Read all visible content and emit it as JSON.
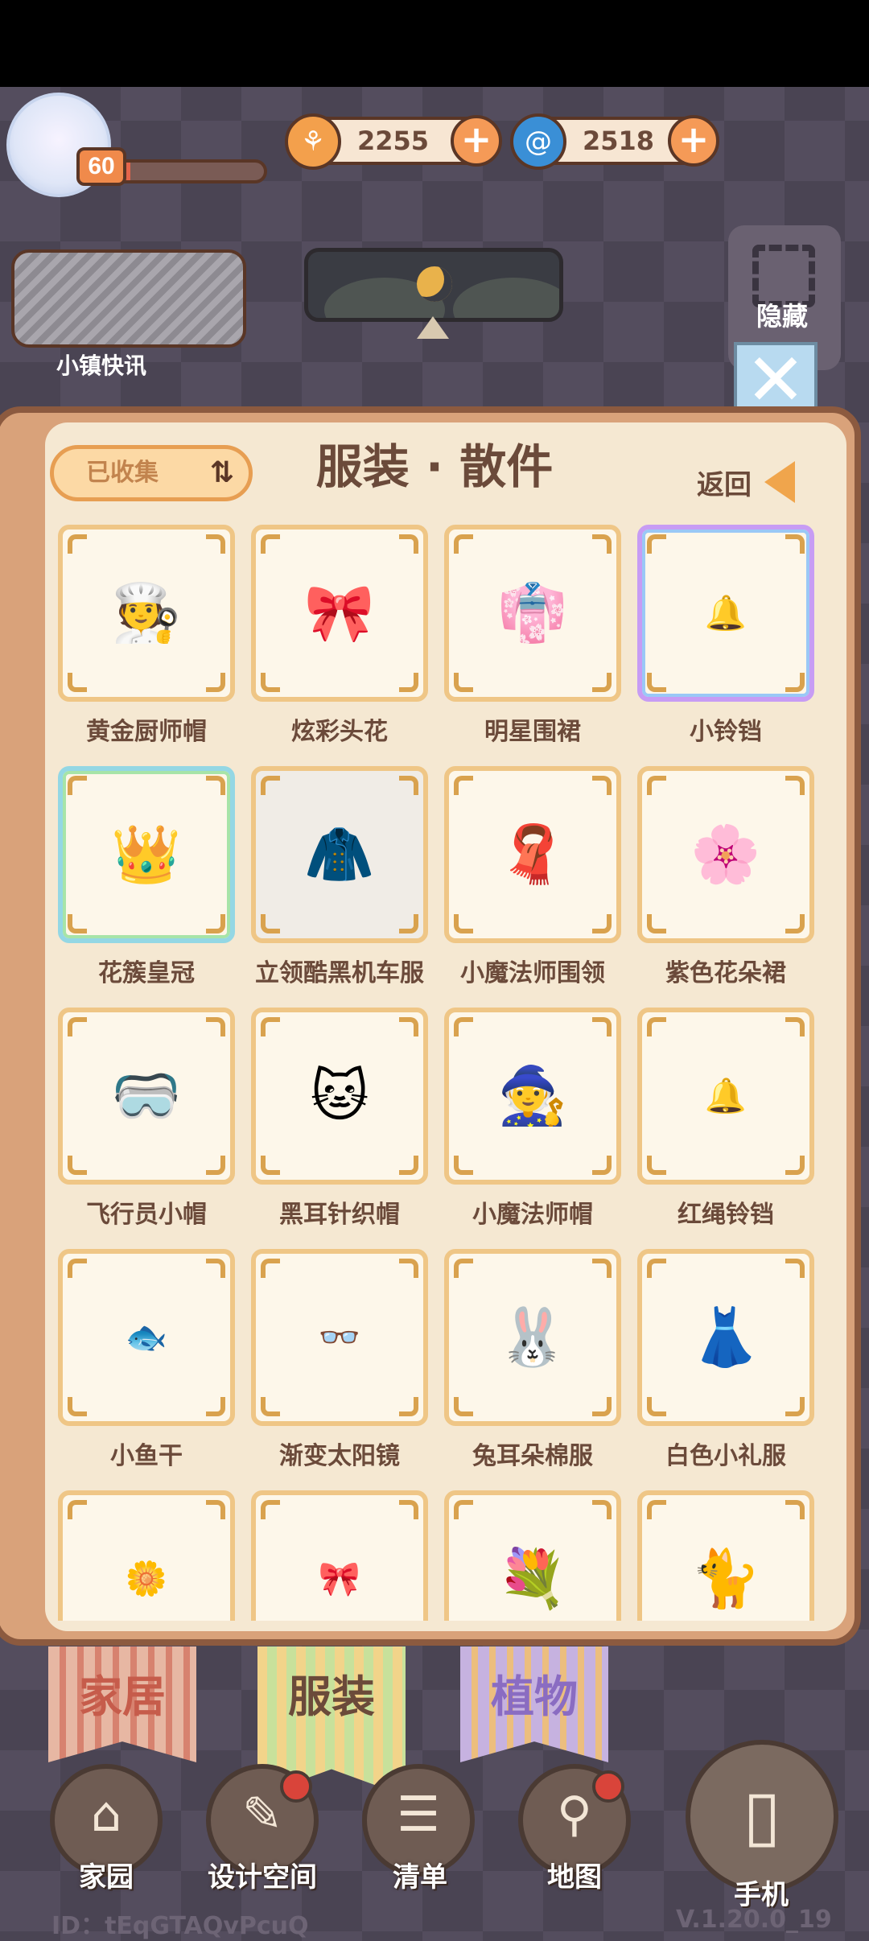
{
  "hud": {
    "level": "60",
    "xp_fraction": 0.1,
    "coins": "2255",
    "gems": "2518",
    "news_label": "小镇快讯",
    "hide_label": "隐藏"
  },
  "panel": {
    "sort_label": "已收集",
    "title": "服装 · 散件",
    "back_label": "返回"
  },
  "items": [
    {
      "name": "黄金厨师帽",
      "icon": "chef-hat",
      "glyph": "🧑‍🍳",
      "rarity": "normal"
    },
    {
      "name": "炫彩头花",
      "icon": "bow",
      "glyph": "🎀",
      "rarity": "normal"
    },
    {
      "name": "明星围裙",
      "icon": "apron",
      "glyph": "👘",
      "rarity": "normal"
    },
    {
      "name": "小铃铛",
      "icon": "bell",
      "glyph": "🔔",
      "rarity": "purple"
    },
    {
      "name": "花簇皇冠",
      "icon": "crown",
      "glyph": "👑",
      "rarity": "blue"
    },
    {
      "name": "立领酷黑机车服",
      "icon": "jacket",
      "glyph": "🧥",
      "rarity": "highlight"
    },
    {
      "name": "小魔法师围领",
      "icon": "collar",
      "glyph": "🧣",
      "rarity": "normal"
    },
    {
      "name": "紫色花朵裙",
      "icon": "flower-skirt",
      "glyph": "🌸",
      "rarity": "normal"
    },
    {
      "name": "飞行员小帽",
      "icon": "aviator-cap",
      "glyph": "🥽",
      "rarity": "normal"
    },
    {
      "name": "黑耳针织帽",
      "icon": "knit-hat",
      "glyph": "🐱",
      "rarity": "normal"
    },
    {
      "name": "小魔法师帽",
      "icon": "wizard-hat",
      "glyph": "🧙",
      "rarity": "normal"
    },
    {
      "name": "红绳铃铛",
      "icon": "red-bell",
      "glyph": "🔔",
      "rarity": "normal"
    },
    {
      "name": "小鱼干",
      "icon": "fish",
      "glyph": "🐟",
      "rarity": "normal"
    },
    {
      "name": "渐变太阳镜",
      "icon": "sunglasses",
      "glyph": "👓",
      "rarity": "normal"
    },
    {
      "name": "兔耳朵棉服",
      "icon": "bunny-coat",
      "glyph": "🐰",
      "rarity": "normal"
    },
    {
      "name": "白色小礼服",
      "icon": "white-dress",
      "glyph": "👗",
      "rarity": "normal"
    },
    {
      "name": "",
      "icon": "flower-clip",
      "glyph": "🌼",
      "rarity": "normal"
    },
    {
      "name": "",
      "icon": "bow-tie",
      "glyph": "🎀",
      "rarity": "normal"
    },
    {
      "name": "",
      "icon": "flower-band",
      "glyph": "💐",
      "rarity": "normal"
    },
    {
      "name": "",
      "icon": "cat-headband",
      "glyph": "🐈",
      "rarity": "normal"
    }
  ],
  "tabs": [
    {
      "label": "家居"
    },
    {
      "label": "服装"
    },
    {
      "label": "植物"
    }
  ],
  "nav": [
    {
      "label": "家园",
      "icon": "home-icon",
      "glyph": "⌂"
    },
    {
      "label": "设计空间",
      "icon": "design-icon",
      "glyph": "✎"
    },
    {
      "label": "清单",
      "icon": "list-icon",
      "glyph": "☰"
    },
    {
      "label": "地图",
      "icon": "map-pin-icon",
      "glyph": "⚲"
    }
  ],
  "phone_label": "手机",
  "footer": {
    "id": "ID：tEqGTAQvPcuQ",
    "version": "V.1.20.0_19"
  }
}
